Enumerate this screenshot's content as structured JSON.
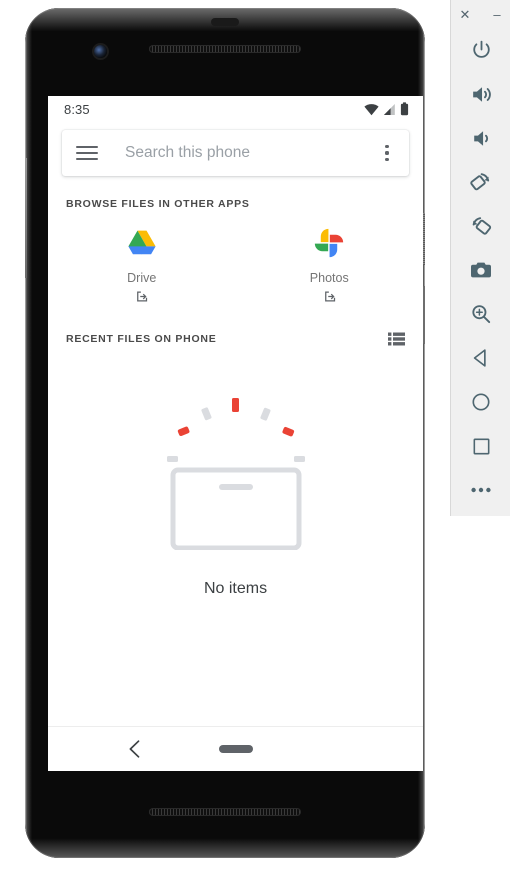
{
  "emulator_toolbar": {
    "window_buttons": [
      {
        "name": "close",
        "glyph": "✕"
      },
      {
        "name": "minimize",
        "glyph": "–"
      }
    ],
    "buttons": [
      {
        "name": "power",
        "label": "Power"
      },
      {
        "name": "volume-up",
        "label": "Volume Up"
      },
      {
        "name": "volume-down",
        "label": "Volume Down"
      },
      {
        "name": "rotate-left",
        "label": "Rotate Left"
      },
      {
        "name": "rotate-right",
        "label": "Rotate Right"
      },
      {
        "name": "screenshot",
        "label": "Take Screenshot"
      },
      {
        "name": "zoom",
        "label": "Enter Zoom Mode"
      },
      {
        "name": "back",
        "label": "Back"
      },
      {
        "name": "home",
        "label": "Home"
      },
      {
        "name": "overview",
        "label": "Overview"
      },
      {
        "name": "more",
        "label": "More"
      }
    ],
    "background_color": "#f0f0f0",
    "icon_color": "#4e6670"
  },
  "device": {
    "model": "Pixel 2",
    "frame_color": "#0a0a0a"
  },
  "phone": {
    "status_bar": {
      "time": "8:35",
      "icons": [
        "wifi-icon",
        "cellular-signal-icon",
        "battery-icon"
      ]
    },
    "search": {
      "menu_icon": "hamburger-menu-icon",
      "placeholder": "Search this phone",
      "value": "",
      "overflow_icon": "overflow-menu-icon"
    },
    "sections": [
      {
        "title": "BROWSE FILES IN OTHER APPS",
        "apps": [
          {
            "label": "Drive",
            "icon": "google-drive-icon",
            "badge": "open-external-icon"
          },
          {
            "label": "Photos",
            "icon": "google-photos-icon",
            "badge": "open-external-icon"
          }
        ]
      },
      {
        "title": "RECENT FILES ON PHONE",
        "view_toggle_icon": "list-view-icon",
        "empty_state": {
          "illustration": "empty-box-confetti-illustration",
          "message": "No items",
          "box_color": "#dadce0",
          "confetti_red": "#ea4335",
          "confetti_gray": "#dadce0"
        }
      }
    ],
    "nav_bar": {
      "back_icon": "back-chevron-icon",
      "home_pill": "home-pill-icon"
    }
  },
  "colors": {
    "accent_blue": "#4285f4",
    "google_red": "#ea4335",
    "google_yellow": "#fbbc04",
    "google_green": "#34a853",
    "text_primary": "#3c4043",
    "text_secondary": "#757575",
    "divider": "#dadce0"
  }
}
